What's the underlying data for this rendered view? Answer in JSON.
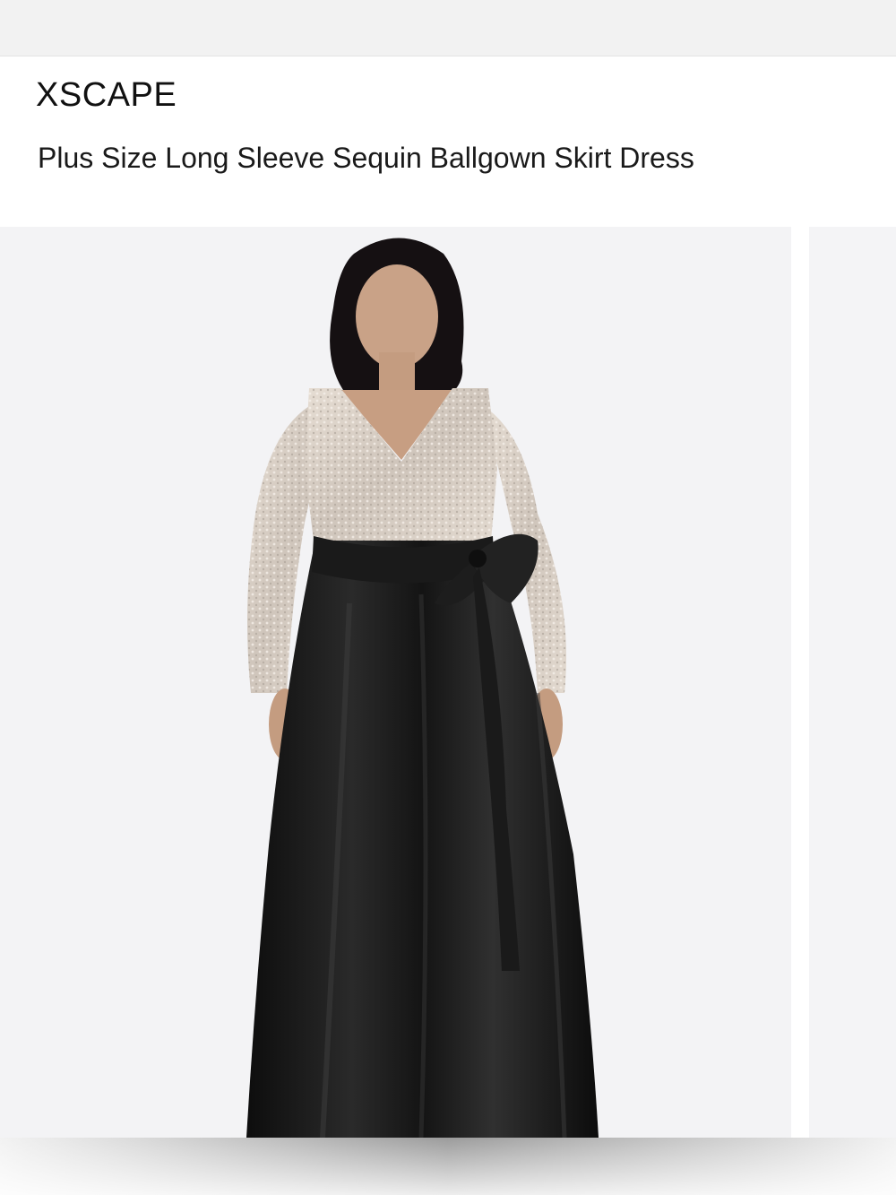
{
  "header": {
    "brand": "XSCAPE",
    "product_title": "Plus Size Long Sleeve Sequin Ballgown Skirt Dress"
  },
  "gallery": {
    "main_image": "model-in-sequin-ballgown-dress",
    "next_image": "partial-next-product-image"
  },
  "colors": {
    "image_background": "#f3f3f5",
    "bodice_sequin": "#d8cfc6",
    "skirt_satin": "#111111",
    "text": "#111111"
  }
}
